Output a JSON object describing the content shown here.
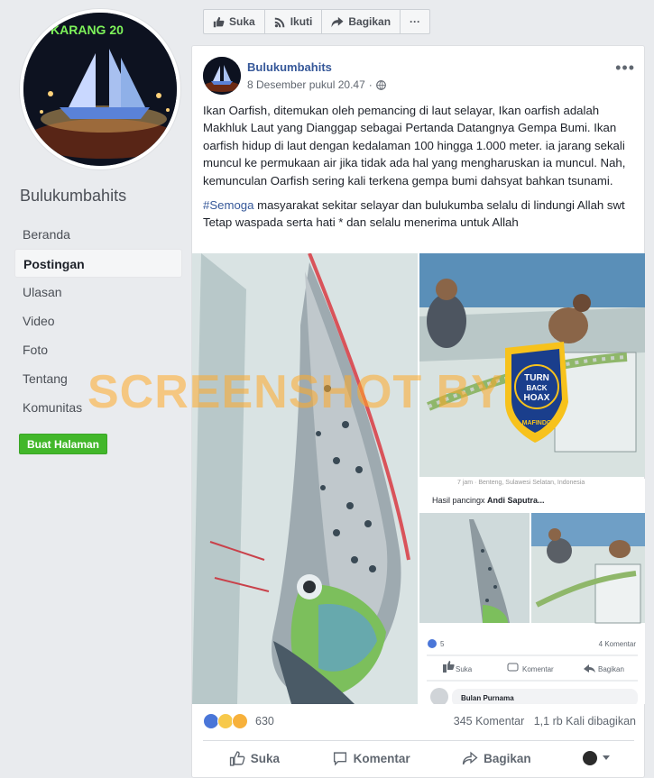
{
  "page": {
    "name": "Bulukumbahits",
    "profile_banner_text": "KARANG 20"
  },
  "nav": {
    "items": [
      "Beranda",
      "Postingan",
      "Ulasan",
      "Video",
      "Foto",
      "Tentang",
      "Komunitas"
    ],
    "active": "Postingan",
    "create_label": "Buat Halaman"
  },
  "topbar": {
    "like": "Suka",
    "follow": "Ikuti",
    "share": "Bagikan",
    "more": "···"
  },
  "post": {
    "author": "Bulukumbahits",
    "timestamp": "8 Desember pukul 20.47",
    "text": "Ikan Oarfish, ditemukan oleh pemancing di laut selayar, Ikan oarfish adalah Makhluk Laut yang Dianggap sebagai Pertanda Datangnya Gempa Bumi. Ikan oarfish hidup di laut dengan kedalaman 100 hingga 1.000 meter. ia jarang sekali muncul ke permukaan air jika tidak ada hal yang mengharuskan ia muncul. Nah, kemunculan Oarfish sering kali terkena gempa bumi dahsyat bahkan tsunami.",
    "hashtag": "#Semoga",
    "text2": " masyarakat sekitar selayar dan bulukumba selalu di lindungi Allah swt Tetap waspada serta hati * dan selalu menerima untuk Allah",
    "reaction_count": "630",
    "comments": "345 Komentar",
    "shares": "1,1 rb Kali dibagikan",
    "actions": {
      "like": "Suka",
      "comment": "Komentar",
      "share": "Bagikan"
    }
  },
  "embedded": {
    "header_text": "7 jam · Benteng, Sulawesi Selatan, Indonesia",
    "caption_prefix": "Hasil pancingx ",
    "caption_name": "Andi Saputra...",
    "likes": "5",
    "comments": "4 Komentar",
    "actions": {
      "like": "Suka",
      "comment": "Komentar",
      "share": "Bagikan"
    },
    "commenter": "Bulan Purnama"
  },
  "badge": {
    "line1": "TURN",
    "line2": "BACK",
    "line3": "HOAX",
    "ring_text": "MASYARAKAT ANTI FITNAH INDONESIA",
    "bottom": "MAFINDO"
  },
  "watermark": "SCREENSHOT BY",
  "colors": {
    "link": "#365899",
    "green": "#42b72a",
    "badge_blue": "#1a3e8c",
    "badge_yellow": "#f7c21c"
  }
}
